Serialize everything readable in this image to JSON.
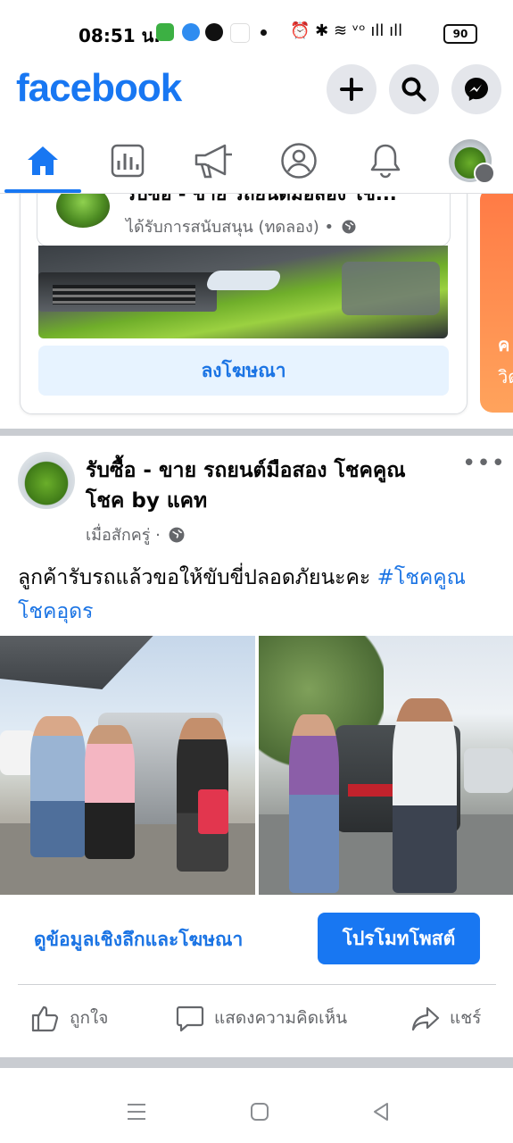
{
  "status_bar": {
    "time": "08:51 น.",
    "battery": "90",
    "network_right": "⏰ ✱ ≋ ᵛᵒ ıll ıll"
  },
  "header": {
    "logo": "facebook",
    "icons": [
      "plus-icon",
      "search-icon",
      "messenger-icon"
    ]
  },
  "tabs": [
    "home-icon",
    "feed-chart-icon",
    "megaphone-icon",
    "profile-icon",
    "bell-icon",
    "avatar-menu-icon"
  ],
  "ad_card": {
    "title": "รับซื้อ - ขาย รถยนต์มือสอง โช...",
    "subtitle": "ได้รับการสนับสนุน (ทดลอง) •",
    "button": "ลงโฆษณา",
    "peek_text_1": "ค",
    "peek_text_2": "วิด"
  },
  "post": {
    "author": "รับซื้อ - ขาย รถยนต์มือสอง โชคคูณโชค by แคท",
    "time": "เมื่อสักครู่ ·",
    "text": "ลูกค้ารับรถแล้วขอให้ขับขี่ปลอดภัยนะคะ ",
    "hashtag": "#โชคคูณโชคอุดร",
    "insights_label": "ดูข้อมูลเชิงลึกและโฆษณา",
    "promote_label": "โปรโมทโพสต์",
    "actions": {
      "like": "ถูกใจ",
      "comment": "แสดงความคิดเห็น",
      "share": "แชร์"
    }
  },
  "colors": {
    "brand": "#1877f2",
    "link": "#1b74e4",
    "secondary_text": "#65676b"
  }
}
